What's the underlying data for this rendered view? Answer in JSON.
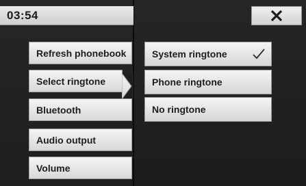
{
  "status_bar": {
    "time": "03:54"
  },
  "close_button": {
    "icon": "close-icon"
  },
  "menu": {
    "items": [
      {
        "label": "Refresh phonebook"
      },
      {
        "label": "Select ringtone"
      },
      {
        "label": "Bluetooth"
      },
      {
        "label": "Audio output"
      },
      {
        "label": "Volume"
      }
    ],
    "selected_index": 1
  },
  "submenu": {
    "items": [
      {
        "label": "System ringtone",
        "checked": true,
        "icon": "checkmark-icon"
      },
      {
        "label": "Phone ringtone",
        "checked": false
      },
      {
        "label": "No ringtone",
        "checked": false
      }
    ]
  },
  "colors": {
    "button_top": "#f4f4f4",
    "button_bottom": "#d8d8d8",
    "background": "#1a1a1a",
    "text": "#1d1d1d"
  }
}
